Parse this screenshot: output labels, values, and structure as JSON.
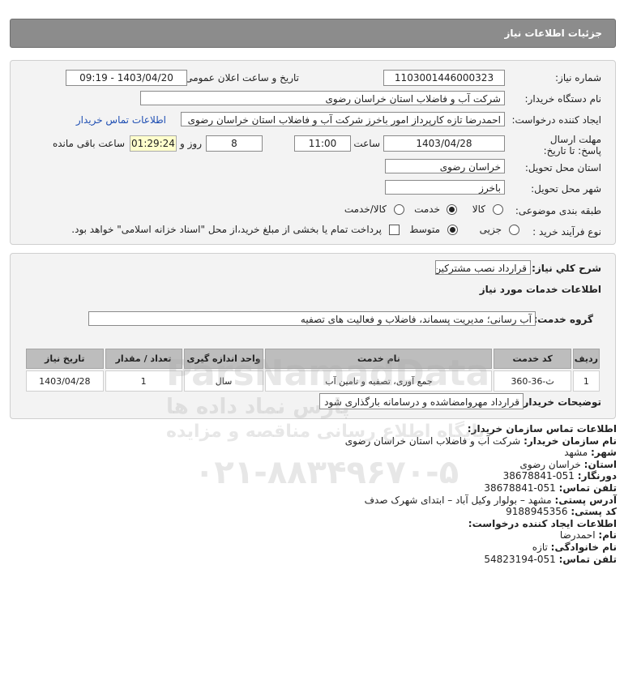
{
  "header": {
    "title": "جزئیات اطلاعات نیاز"
  },
  "info": {
    "need_number_label": "شماره نیاز:",
    "need_number": "1103001446000323",
    "announce_label": "تاریخ و ساعت اعلان عمومی:",
    "announce_value": "1403/04/20 - 09:19",
    "buyer_org_label": "نام دستگاه خریدار:",
    "buyer_org": "شرکت آب و فاضلاب استان خراسان رضوی",
    "creator_label": "ایجاد کننده درخواست:",
    "creator": "احمدرضا تازه کارپرداز امور باخرز  شرکت آب و فاضلاب استان خراسان رضوی",
    "contact_link": "اطلاعات تماس خریدار",
    "deadline_label": "مهلت ارسال پاسخ: تا تاریخ:",
    "deadline_date": "1403/04/28",
    "time_label": "ساعت",
    "deadline_time": "11:00",
    "days_value": "8",
    "days_label": "روز و",
    "remaining_time": "01:29:24",
    "remaining_label": "ساعت باقی مانده",
    "province_label": "استان محل تحویل:",
    "province": "خراسان رضوی",
    "city_label": "شهر محل تحویل:",
    "city": "باخرز",
    "category_label": "طبقه بندی موضوعی:",
    "category_options": [
      "کالا",
      "خدمت",
      "کالا/خدمت"
    ],
    "category_selected": "خدمت",
    "process_label": "نوع فرآیند خرید :",
    "process_options": [
      "جزیی",
      "متوسط"
    ],
    "process_selected": "متوسط",
    "payment_note": "پرداخت تمام یا بخشی از مبلغ خرید،از محل \"اسناد خزانه اسلامی\" خواهد بود."
  },
  "details": {
    "summary_label": "شرح کلي نياز:",
    "summary": "قرارداد نصب مشترکین",
    "services_heading": "اطلاعات خدمات مورد نیاز",
    "service_group_label": "گروه خدمت:",
    "service_group": "آب رسانی؛ مدیریت پسماند، فاضلاب و فعالیت های تصفیه",
    "table": {
      "headers": [
        "ردیف",
        "کد خدمت",
        "نام خدمت",
        "واحد اندازه گیری",
        "تعداد / مقدار",
        "تاریخ نیاز"
      ],
      "rows": [
        [
          "1",
          "ث-36-360",
          "جمع آوری، تصفیه و تامین آب",
          "سال",
          "1",
          "1403/04/28"
        ]
      ]
    },
    "buyer_notes_label": "توضیحات خریدار:",
    "buyer_notes": "قرارداد مهروامضاشده و درسامانه بارگذاری شود"
  },
  "contact": {
    "title": "اطلاعات تماس سازمان خریدار:",
    "org_label": "نام سازمان خریدار:",
    "org": "شرکت آب و فاضلاب استان خراسان رضوی",
    "city_label": "شهر:",
    "city": "مشهد",
    "province_label": "استان:",
    "province": "خراسان رضوی",
    "fax_label": "دورنگار:",
    "fax": "051-38678841",
    "phone_label": "تلفن تماس:",
    "phone": "051-38678841",
    "address_label": "آدرس پستی:",
    "address": "مشهد – بولوار وکیل آباد – ابتدای شهرک صدف",
    "postal_label": "کد پستی:",
    "postal": "9188945356",
    "creator_title": "اطلاعات ایجاد کننده درخواست:",
    "name_label": "نام:",
    "name": "احمدرضا",
    "family_label": "نام خانوادگی:",
    "family": "تازه",
    "creator_phone_label": "تلفن تماس:",
    "creator_phone": "051-54823194"
  },
  "watermark": {
    "brand": "ParsNamadData",
    "persian": "پارس نماد داده ها",
    "tagline": "پایگاه اطلاع رسانی مناقصه و مزایده",
    "phone": "۰۲۱-۸۸۳۴۹۶۷۰-۵"
  }
}
